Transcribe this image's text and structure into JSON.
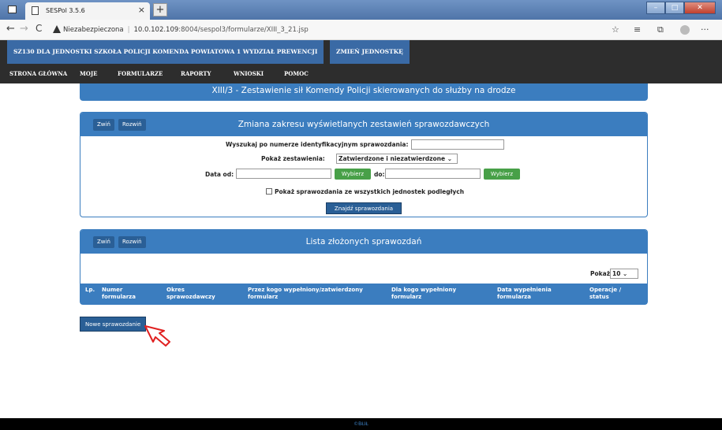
{
  "browser": {
    "tab_title": "SESPol 3.5.6",
    "tab_close": "×",
    "new_tab": "+",
    "security_label": "Niezabezpieczona",
    "url_host": "10.0.102.109",
    "url_rest": ":8004/sespol3/formularze/XIII_3_21.jsp",
    "nav_back": "←",
    "nav_forward": "→",
    "nav_reload": "C",
    "more": "···"
  },
  "header": {
    "unit_name": "SZ130 DLA JEDNOSTKI SZKOŁA POLICJI KOMENDA POWIATOWA 1 WYDZIAŁ PREWENCJI",
    "change_unit": "ZMIEŃ JEDNOSTKĘ"
  },
  "menu": {
    "items": [
      "STRONA GŁÓWNA",
      "MOJE",
      "FORMULARZE",
      "RAPORTY",
      "WNIOSKI",
      "POMOC"
    ]
  },
  "form_title": "XIII/3 - Zestawienie sił Komendy Policji skierowanych do służby na drodze",
  "filter_panel": {
    "collapse": "Zwiń",
    "expand": "Rozwiń",
    "title": "Zmiana zakresu wyświetlanych zestawień sprawozdawczych",
    "search_label": "Wyszukaj po numerze identyfikacyjnym sprawozdania:",
    "search_value": "",
    "show_label": "Pokaż zestawienia:",
    "show_value": "Zatwierdzone i niezatwierdzone",
    "date_from_label": "Data od:",
    "date_from_value": "",
    "choose1": "Wybierz",
    "date_to_label": "do:",
    "date_to_value": "",
    "choose2": "Wybierz",
    "all_units_label": "Pokaż sprawozdania ze wszystkich jednostek podległych",
    "find_button": "Znajdź sprawozdania"
  },
  "list_panel": {
    "collapse": "Zwiń",
    "expand": "Rozwiń",
    "title": "Lista złożonych sprawozdań",
    "show_label": "Pokaż",
    "show_value": "10",
    "columns": [
      "Lp.",
      "Numer formularza",
      "Okres sprawozdawczy",
      "Przez kogo wypełniony/zatwierdzony formularz",
      "Dla kogo wypełniony formularz",
      "Data wypełnienia formularza",
      "Operacje / status"
    ]
  },
  "new_report_button": "Nowe sprawozdanie",
  "footer": "©BŁIŁ"
}
